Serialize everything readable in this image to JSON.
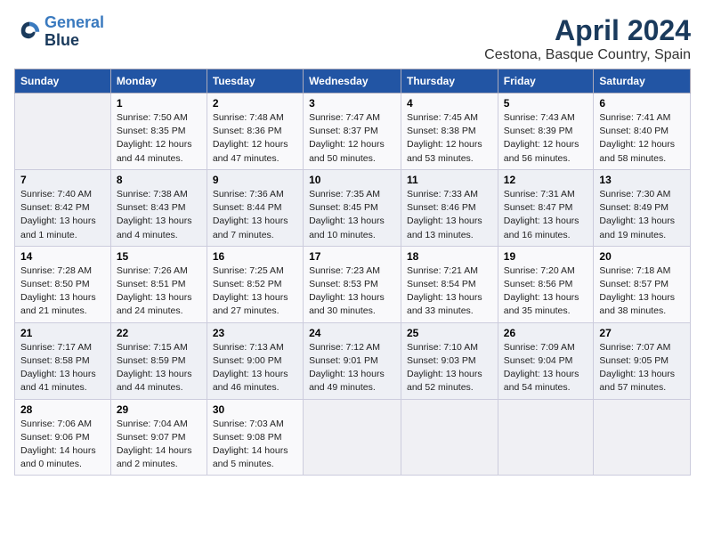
{
  "header": {
    "logo_line1": "General",
    "logo_line2": "Blue",
    "title": "April 2024",
    "subtitle": "Cestona, Basque Country, Spain"
  },
  "days_of_week": [
    "Sunday",
    "Monday",
    "Tuesday",
    "Wednesday",
    "Thursday",
    "Friday",
    "Saturday"
  ],
  "weeks": [
    [
      {
        "day": "",
        "text": ""
      },
      {
        "day": "1",
        "text": "Sunrise: 7:50 AM\nSunset: 8:35 PM\nDaylight: 12 hours\nand 44 minutes."
      },
      {
        "day": "2",
        "text": "Sunrise: 7:48 AM\nSunset: 8:36 PM\nDaylight: 12 hours\nand 47 minutes."
      },
      {
        "day": "3",
        "text": "Sunrise: 7:47 AM\nSunset: 8:37 PM\nDaylight: 12 hours\nand 50 minutes."
      },
      {
        "day": "4",
        "text": "Sunrise: 7:45 AM\nSunset: 8:38 PM\nDaylight: 12 hours\nand 53 minutes."
      },
      {
        "day": "5",
        "text": "Sunrise: 7:43 AM\nSunset: 8:39 PM\nDaylight: 12 hours\nand 56 minutes."
      },
      {
        "day": "6",
        "text": "Sunrise: 7:41 AM\nSunset: 8:40 PM\nDaylight: 12 hours\nand 58 minutes."
      }
    ],
    [
      {
        "day": "7",
        "text": "Sunrise: 7:40 AM\nSunset: 8:42 PM\nDaylight: 13 hours\nand 1 minute."
      },
      {
        "day": "8",
        "text": "Sunrise: 7:38 AM\nSunset: 8:43 PM\nDaylight: 13 hours\nand 4 minutes."
      },
      {
        "day": "9",
        "text": "Sunrise: 7:36 AM\nSunset: 8:44 PM\nDaylight: 13 hours\nand 7 minutes."
      },
      {
        "day": "10",
        "text": "Sunrise: 7:35 AM\nSunset: 8:45 PM\nDaylight: 13 hours\nand 10 minutes."
      },
      {
        "day": "11",
        "text": "Sunrise: 7:33 AM\nSunset: 8:46 PM\nDaylight: 13 hours\nand 13 minutes."
      },
      {
        "day": "12",
        "text": "Sunrise: 7:31 AM\nSunset: 8:47 PM\nDaylight: 13 hours\nand 16 minutes."
      },
      {
        "day": "13",
        "text": "Sunrise: 7:30 AM\nSunset: 8:49 PM\nDaylight: 13 hours\nand 19 minutes."
      }
    ],
    [
      {
        "day": "14",
        "text": "Sunrise: 7:28 AM\nSunset: 8:50 PM\nDaylight: 13 hours\nand 21 minutes."
      },
      {
        "day": "15",
        "text": "Sunrise: 7:26 AM\nSunset: 8:51 PM\nDaylight: 13 hours\nand 24 minutes."
      },
      {
        "day": "16",
        "text": "Sunrise: 7:25 AM\nSunset: 8:52 PM\nDaylight: 13 hours\nand 27 minutes."
      },
      {
        "day": "17",
        "text": "Sunrise: 7:23 AM\nSunset: 8:53 PM\nDaylight: 13 hours\nand 30 minutes."
      },
      {
        "day": "18",
        "text": "Sunrise: 7:21 AM\nSunset: 8:54 PM\nDaylight: 13 hours\nand 33 minutes."
      },
      {
        "day": "19",
        "text": "Sunrise: 7:20 AM\nSunset: 8:56 PM\nDaylight: 13 hours\nand 35 minutes."
      },
      {
        "day": "20",
        "text": "Sunrise: 7:18 AM\nSunset: 8:57 PM\nDaylight: 13 hours\nand 38 minutes."
      }
    ],
    [
      {
        "day": "21",
        "text": "Sunrise: 7:17 AM\nSunset: 8:58 PM\nDaylight: 13 hours\nand 41 minutes."
      },
      {
        "day": "22",
        "text": "Sunrise: 7:15 AM\nSunset: 8:59 PM\nDaylight: 13 hours\nand 44 minutes."
      },
      {
        "day": "23",
        "text": "Sunrise: 7:13 AM\nSunset: 9:00 PM\nDaylight: 13 hours\nand 46 minutes."
      },
      {
        "day": "24",
        "text": "Sunrise: 7:12 AM\nSunset: 9:01 PM\nDaylight: 13 hours\nand 49 minutes."
      },
      {
        "day": "25",
        "text": "Sunrise: 7:10 AM\nSunset: 9:03 PM\nDaylight: 13 hours\nand 52 minutes."
      },
      {
        "day": "26",
        "text": "Sunrise: 7:09 AM\nSunset: 9:04 PM\nDaylight: 13 hours\nand 54 minutes."
      },
      {
        "day": "27",
        "text": "Sunrise: 7:07 AM\nSunset: 9:05 PM\nDaylight: 13 hours\nand 57 minutes."
      }
    ],
    [
      {
        "day": "28",
        "text": "Sunrise: 7:06 AM\nSunset: 9:06 PM\nDaylight: 14 hours\nand 0 minutes."
      },
      {
        "day": "29",
        "text": "Sunrise: 7:04 AM\nSunset: 9:07 PM\nDaylight: 14 hours\nand 2 minutes."
      },
      {
        "day": "30",
        "text": "Sunrise: 7:03 AM\nSunset: 9:08 PM\nDaylight: 14 hours\nand 5 minutes."
      },
      {
        "day": "",
        "text": ""
      },
      {
        "day": "",
        "text": ""
      },
      {
        "day": "",
        "text": ""
      },
      {
        "day": "",
        "text": ""
      }
    ]
  ]
}
